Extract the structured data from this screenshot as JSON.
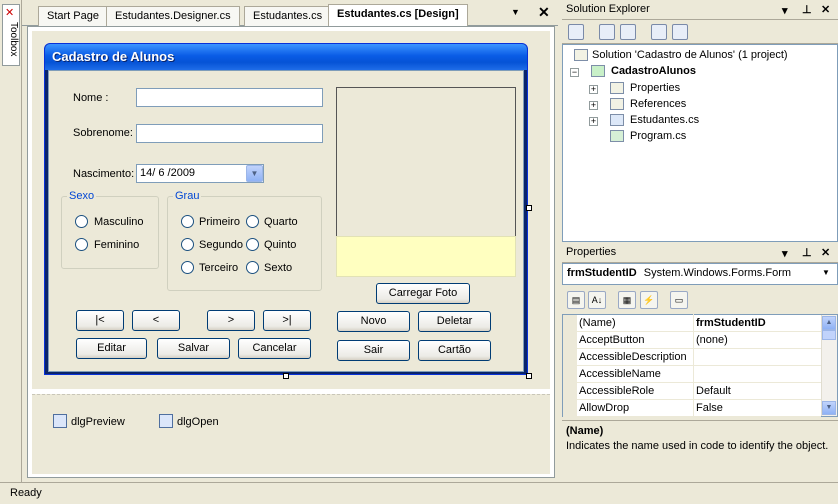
{
  "toolbox": {
    "label": "Toolbox"
  },
  "document_tabs": [
    {
      "label": "Start Page"
    },
    {
      "label": "Estudantes.Designer.cs"
    },
    {
      "label": "Estudantes.cs"
    },
    {
      "label": "Estudantes.cs [Design]"
    }
  ],
  "form": {
    "title": "Cadastro de Alunos",
    "labels": {
      "nome": "Nome :",
      "sobrenome": "Sobrenome:",
      "nascimento": "Nascimento:"
    },
    "fields": {
      "nome": "",
      "sobrenome": "",
      "nascimento": "14/ 6 /2009"
    },
    "sexo": {
      "title": "Sexo",
      "options": [
        "Masculino",
        "Feminino"
      ]
    },
    "grau": {
      "title": "Grau",
      "options": [
        "Primeiro",
        "Quarto",
        "Segundo",
        "Quinto",
        "Terceiro",
        "Sexto"
      ]
    },
    "buttons": {
      "first": "|<",
      "prev": "<",
      "next": ">",
      "last": ">|",
      "editar": "Editar",
      "salvar": "Salvar",
      "cancelar": "Cancelar",
      "carregar_foto": "Carregar Foto",
      "novo": "Novo",
      "deletar": "Deletar",
      "sair": "Sair",
      "cartao": "Cartão"
    }
  },
  "tray": [
    {
      "label": "dlgPreview"
    },
    {
      "label": "dlgOpen"
    }
  ],
  "solution_explorer": {
    "title": "Solution Explorer",
    "solution": "Solution 'Cadastro de Alunos' (1 project)",
    "project": "CadastroAlunos",
    "items": [
      "Properties",
      "References",
      "Estudantes.cs",
      "Program.cs"
    ]
  },
  "properties": {
    "title": "Properties",
    "object_name": "frmStudentID",
    "object_type": "System.Windows.Forms.Form",
    "rows": [
      {
        "name": "(Name)",
        "value": "frmStudentID"
      },
      {
        "name": "AcceptButton",
        "value": "(none)"
      },
      {
        "name": "AccessibleDescription",
        "value": ""
      },
      {
        "name": "AccessibleName",
        "value": ""
      },
      {
        "name": "AccessibleRole",
        "value": "Default"
      },
      {
        "name": "AllowDrop",
        "value": "False"
      }
    ],
    "description_title": "(Name)",
    "description_text": "Indicates the name used in code to identify the object."
  },
  "status": "Ready"
}
